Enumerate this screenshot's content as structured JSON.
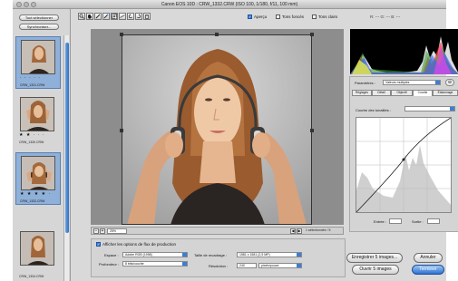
{
  "window": {
    "title": "Canon EOS 10D : CRW_1332.CRW  (ISO 100, 1/180, f/11, 100 mm)"
  },
  "filmstrip": {
    "select_all_label": "Tout sélectionner",
    "synchronize_label": "Synchroniser...",
    "thumbnails": [
      {
        "filename": "CRW_1331.CRW",
        "rating": 0,
        "stars": "· · · · ·",
        "selected": true
      },
      {
        "filename": "CRW_1330.CRW",
        "rating": 2,
        "stars": "★ ★ · · ·",
        "selected": false
      },
      {
        "filename": "CRW_1332.CRW",
        "rating": 4,
        "stars": "★ ★ ★ ★ ·",
        "selected": true
      },
      {
        "filename": "CRW_1334.CRW",
        "rating": 0,
        "stars": "",
        "selected": false
      }
    ]
  },
  "toolbar": {
    "tools": [
      {
        "name": "zoom-tool",
        "glyph": "🔍"
      },
      {
        "name": "hand-tool",
        "glyph": "✋"
      },
      {
        "name": "white-balance-tool",
        "glyph": "⁄"
      },
      {
        "name": "color-sampler-tool",
        "glyph": "✚"
      },
      {
        "name": "crop-tool",
        "glyph": "▣"
      },
      {
        "name": "straighten-tool",
        "glyph": "◩"
      },
      {
        "name": "rotate-left-tool",
        "glyph": "↺"
      },
      {
        "name": "rotate-right-tool",
        "glyph": "↻"
      },
      {
        "name": "trash-tool",
        "glyph": "🗑"
      }
    ],
    "preview_label": "Aperçu",
    "preview_checked": true,
    "shadows_label": "Tons foncés",
    "highlights_label": "Tons clairs",
    "rgb_label": "R: --- G: --- B: ---"
  },
  "preview": {
    "zoom_value": "25%",
    "selection_status": "1 sélectionnée / 5"
  },
  "workflow": {
    "toggle_label": "Afficher les options de flux de production",
    "toggle_checked": true,
    "space_label": "Espace :",
    "space_value": "Adobe RGB (1998)",
    "crop_size_label": "Taille de recadrage :",
    "crop_size_value": "1581 x 1581 (2,5 MP)",
    "depth_label": "Profondeur :",
    "depth_value": "8 bits/couche",
    "resolution_label": "Résolution :",
    "resolution_value": "240",
    "resolution_unit": "pixels/pouce"
  },
  "rightpanel": {
    "settings_label": "Paramètres :",
    "settings_value": "Valeurs multiples",
    "tabs": [
      "Réglages",
      "Détail",
      "Objectif",
      "Courbe",
      "Étalonnage"
    ],
    "active_tab": "Courbe",
    "curve_label": "Courbe des tonalités :",
    "curve_value": "",
    "input_label": "Entrée :",
    "output_label": "Sortie :"
  },
  "actions": {
    "save_label": "Enregistrer 5 images...",
    "cancel_label": "Annuler",
    "open_label": "Ouvrir 5 images",
    "done_label": "Terminer"
  },
  "colors": {
    "accent": "#3d7ed6",
    "selection": "#8fb0d8"
  }
}
